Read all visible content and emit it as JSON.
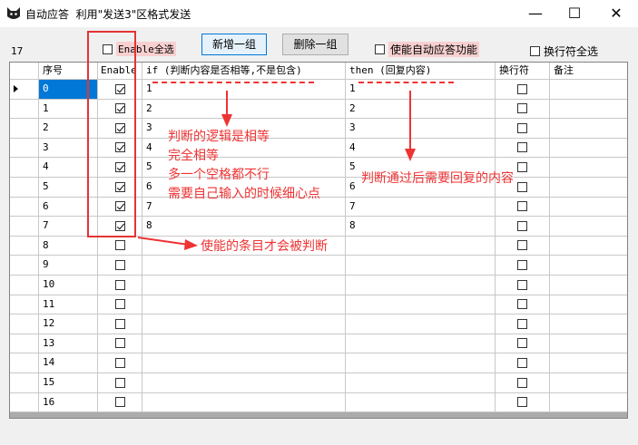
{
  "window": {
    "title": "自动应答  利用\"发送3\"区格式发送",
    "min": "—",
    "max": "☐",
    "close": "✕",
    "icon": "cat-icon"
  },
  "toolbar": {
    "count": "17",
    "enable_all": "Enable全选",
    "add_group": "新增一组",
    "delete_group": "删除一组",
    "enable_auto": "使能自动应答功能",
    "newline_all": "换行符全选"
  },
  "grid": {
    "headers": [
      "",
      "序号",
      "Enable",
      "if (判断内容是否相等,不是包含)",
      "then (回复内容)",
      "换行符",
      "备注"
    ],
    "rows": [
      {
        "id": "0",
        "enable": true,
        "if": "1",
        "then": "1",
        "newline": false,
        "note": ""
      },
      {
        "id": "1",
        "enable": true,
        "if": "2",
        "then": "2",
        "newline": false,
        "note": ""
      },
      {
        "id": "2",
        "enable": true,
        "if": "3",
        "then": "3",
        "newline": false,
        "note": ""
      },
      {
        "id": "3",
        "enable": true,
        "if": "4",
        "then": "4",
        "newline": false,
        "note": ""
      },
      {
        "id": "4",
        "enable": true,
        "if": "5",
        "then": "5",
        "newline": false,
        "note": ""
      },
      {
        "id": "5",
        "enable": true,
        "if": "6",
        "then": "6",
        "newline": false,
        "note": ""
      },
      {
        "id": "6",
        "enable": true,
        "if": "7",
        "then": "7",
        "newline": false,
        "note": ""
      },
      {
        "id": "7",
        "enable": true,
        "if": "8",
        "then": "8",
        "newline": false,
        "note": ""
      },
      {
        "id": "8",
        "enable": false,
        "if": "",
        "then": "",
        "newline": false,
        "note": ""
      },
      {
        "id": "9",
        "enable": false,
        "if": "",
        "then": "",
        "newline": false,
        "note": ""
      },
      {
        "id": "10",
        "enable": false,
        "if": "",
        "then": "",
        "newline": false,
        "note": ""
      },
      {
        "id": "11",
        "enable": false,
        "if": "",
        "then": "",
        "newline": false,
        "note": ""
      },
      {
        "id": "12",
        "enable": false,
        "if": "",
        "then": "",
        "newline": false,
        "note": ""
      },
      {
        "id": "13",
        "enable": false,
        "if": "",
        "then": "",
        "newline": false,
        "note": ""
      },
      {
        "id": "14",
        "enable": false,
        "if": "",
        "then": "",
        "newline": false,
        "note": ""
      },
      {
        "id": "15",
        "enable": false,
        "if": "",
        "then": "",
        "newline": false,
        "note": ""
      },
      {
        "id": "16",
        "enable": false,
        "if": "",
        "then": "",
        "newline": false,
        "note": ""
      }
    ]
  },
  "annotations": {
    "logic": [
      "判断的逻辑是相等",
      "完全相等",
      "多一个空格都不行",
      "需要自己输入的时候细心点"
    ],
    "reply": "判断通过后需要回复的内容",
    "enabled": "使能的条目才会被判断",
    "color": "#ee3333"
  }
}
